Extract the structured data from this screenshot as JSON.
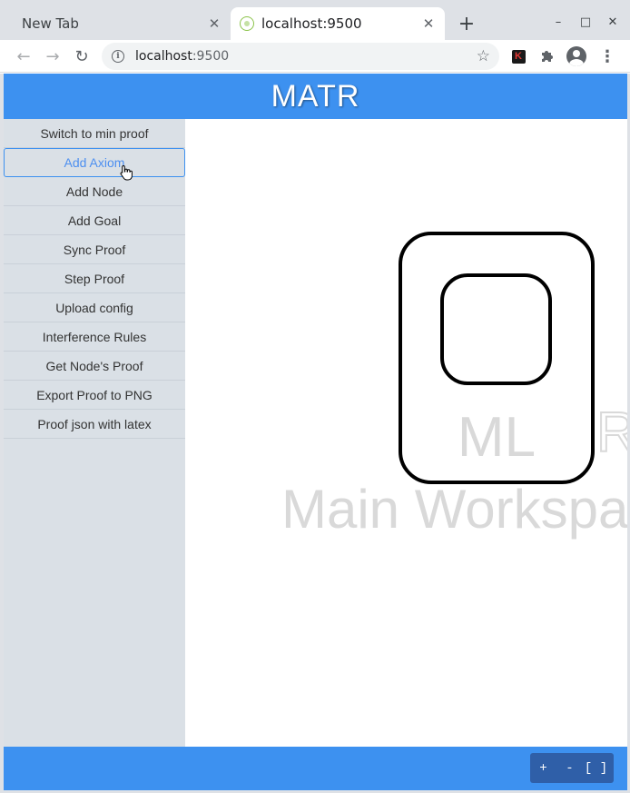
{
  "browser": {
    "tabs": [
      {
        "title": "New Tab",
        "active": false
      },
      {
        "title": "localhost:9500",
        "active": true
      }
    ],
    "new_tab_symbol": "+",
    "window_controls": {
      "minimize": "–",
      "maximize": "□",
      "close": "✕"
    },
    "url_host": "localhost",
    "url_port": ":9500",
    "nav": {
      "back": "←",
      "forward": "→",
      "reload": "↻"
    },
    "extension_letter": "K"
  },
  "app": {
    "title": "MATR",
    "accent_color": "#3d91f0",
    "sidebar": {
      "items": [
        {
          "label": "Switch to min proof"
        },
        {
          "label": "Add Axiom"
        },
        {
          "label": "Add Node"
        },
        {
          "label": "Add Goal"
        },
        {
          "label": "Sync Proof"
        },
        {
          "label": "Step Proof"
        },
        {
          "label": "Upload config"
        },
        {
          "label": "Interference Rules"
        },
        {
          "label": "Get Node's Proof"
        },
        {
          "label": "Export Proof to PNG"
        },
        {
          "label": "Proof json with latex"
        }
      ],
      "hovered_item": "Add Axiom"
    },
    "workspace": {
      "logo_text_left": "ML",
      "logo_text_right": "R",
      "watermark": "Main Workspa"
    },
    "footer": {
      "zoom_in": "+",
      "zoom_out": "-",
      "fit": "[ ]"
    }
  }
}
